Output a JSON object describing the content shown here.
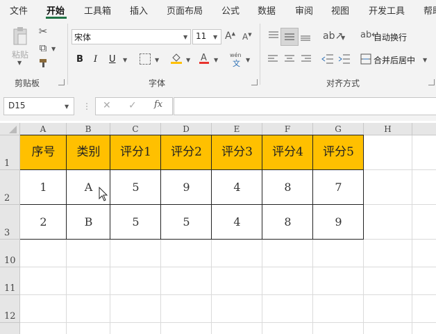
{
  "menu": {
    "tabs": [
      "文件",
      "开始",
      "工具箱",
      "插入",
      "页面布局",
      "公式",
      "数据",
      "审阅",
      "视图",
      "开发工具",
      "帮助"
    ],
    "active_tab": "开始"
  },
  "ribbon": {
    "clipboard": {
      "label": "剪贴板",
      "paste_label": "粘贴"
    },
    "font": {
      "label": "字体",
      "font_name": "宋体",
      "font_size": "11",
      "bold": "B",
      "italic": "I",
      "underline": "U",
      "phonetic": "wén"
    },
    "align": {
      "label": "对齐方式",
      "wrap_text": "自动换行",
      "merge_center": "合并后居中"
    }
  },
  "formula_bar": {
    "name_box": "D15",
    "fx": "fx",
    "formula": ""
  },
  "sheet": {
    "columns": [
      "A",
      "B",
      "C",
      "D",
      "E",
      "F",
      "G",
      "H"
    ],
    "row_numbers": [
      "1",
      "2",
      "3",
      "10",
      "11",
      "12"
    ],
    "header_fill": "#ffc000",
    "table": {
      "headers": [
        "序号",
        "类别",
        "评分1",
        "评分2",
        "评分3",
        "评分4",
        "评分5"
      ],
      "rows": [
        [
          "1",
          "A",
          "5",
          "9",
          "4",
          "8",
          "7"
        ],
        [
          "2",
          "B",
          "5",
          "5",
          "4",
          "8",
          "9"
        ]
      ]
    }
  },
  "colors": {
    "accent": "#217346",
    "header_fill": "#ffc000"
  }
}
